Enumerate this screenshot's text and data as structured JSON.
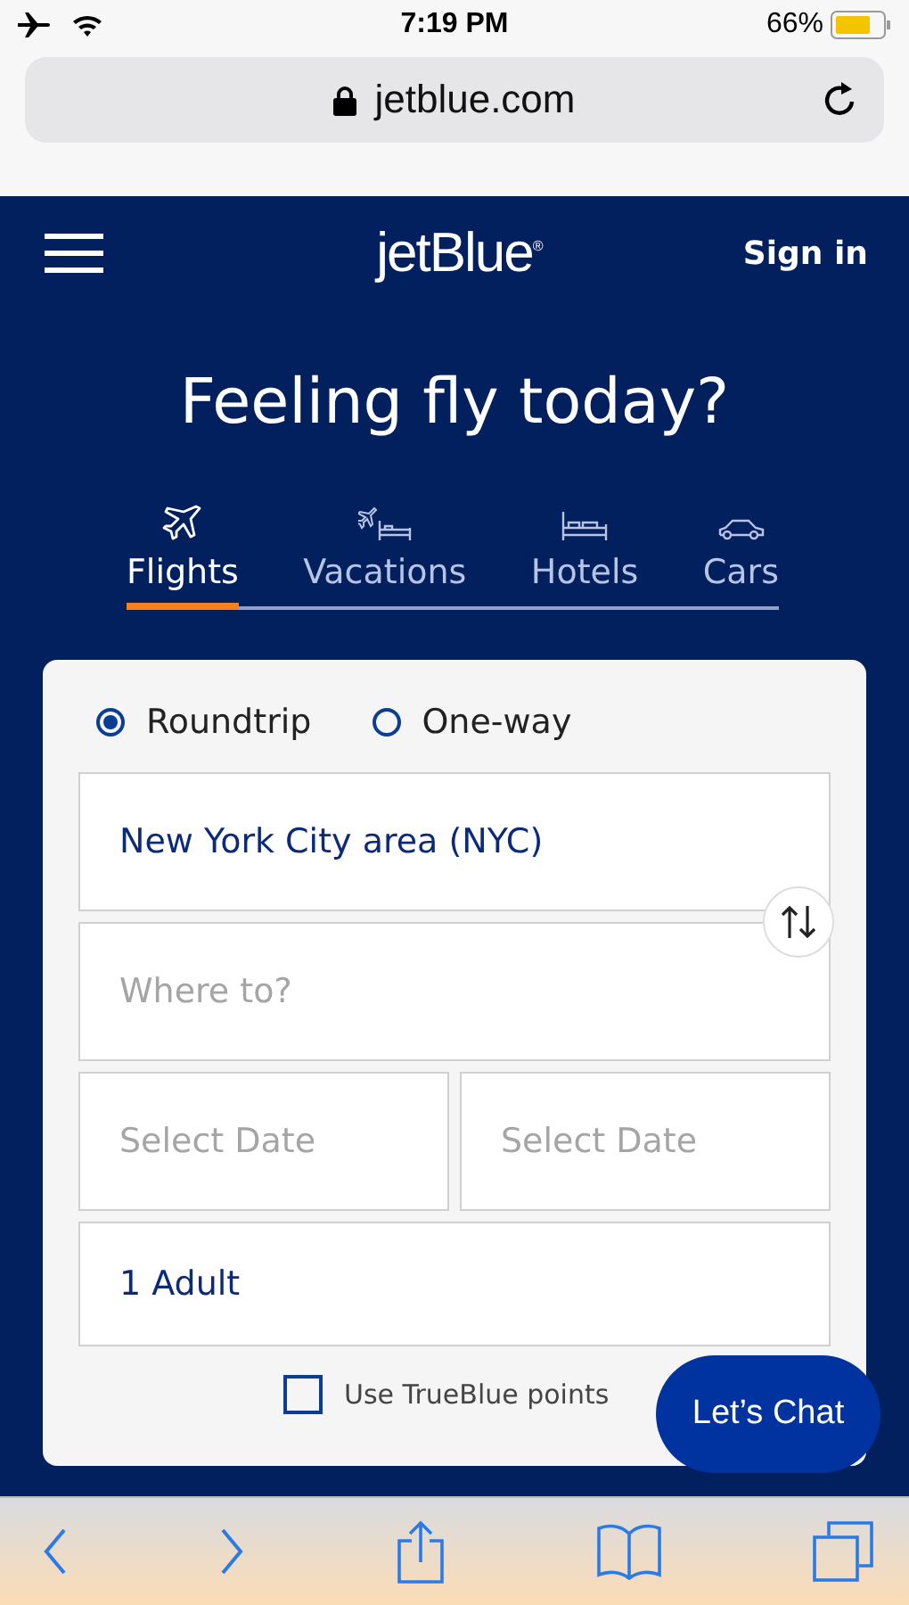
{
  "status_bar": {
    "time": "7:19 PM",
    "battery": "66%"
  },
  "address_bar": {
    "url": "jetblue.com"
  },
  "header": {
    "logo": "jetBlue$^{®}$",
    "sign_in": "Sign in"
  },
  "headline": "Feeling fly today?",
  "tabs": [
    {
      "label": "Flights",
      "kind": "flight",
      "selected": true
    },
    {
      "label": "Vacations",
      "kind": "vacation",
      "selected": false
    },
    {
      "label": "Hotels",
      "kind": "hotel",
      "selected": false
    },
    {
      "label": "Cars",
      "kind": "car",
      "selected": false
    }
  ],
  "trip_types": [
    {
      "label": "Roundtrip",
      "selected": true
    },
    {
      "label": "One-way",
      "selected": false
    }
  ],
  "origin": {
    "value": "New York City area (NYC)"
  },
  "destination": {
    "placeholder": "Where to?"
  },
  "depart_date": {
    "placeholder": "Select Date"
  },
  "return_date": {
    "placeholder": "Select Date"
  },
  "passengers": {
    "value": "1 Adult"
  },
  "points": {
    "label": "Use TrueBlue points",
    "checked": false
  },
  "chat_button": "Let’s Chat"
}
